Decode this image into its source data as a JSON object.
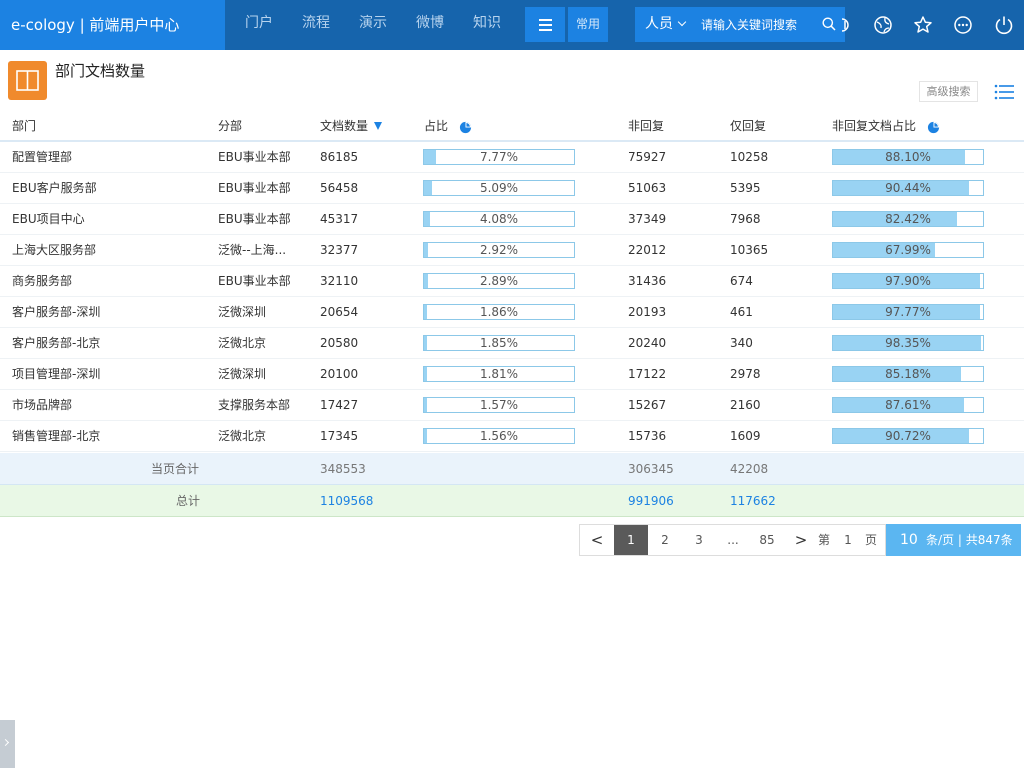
{
  "brand": "e-cology | 前端用户中心",
  "nav": [
    "门户",
    "流程",
    "演示",
    "微博",
    "知识"
  ],
  "common_label": "常用",
  "search": {
    "type": "人员",
    "placeholder": "请输入关键词搜索"
  },
  "title": "部门文档数量",
  "advanced_search_label": "高级搜索",
  "columns": [
    "部门",
    "分部",
    "文档数量",
    "占比",
    "非回复",
    "仅回复",
    "非回复文档占比"
  ],
  "rows": [
    {
      "dept": "配置管理部",
      "branch": "EBU事业本部",
      "docs": "86185",
      "pct": "7.77%",
      "pct_value": 0.0777,
      "nonreply": "75927",
      "reply": "10258",
      "nonreply_pct": "88.10%",
      "nonreply_value": 0.881
    },
    {
      "dept": "EBU客户服务部",
      "branch": "EBU事业本部",
      "docs": "56458",
      "pct": "5.09%",
      "pct_value": 0.0509,
      "nonreply": "51063",
      "reply": "5395",
      "nonreply_pct": "90.44%",
      "nonreply_value": 0.9044
    },
    {
      "dept": "EBU项目中心",
      "branch": "EBU事业本部",
      "docs": "45317",
      "pct": "4.08%",
      "pct_value": 0.0408,
      "nonreply": "37349",
      "reply": "7968",
      "nonreply_pct": "82.42%",
      "nonreply_value": 0.8242
    },
    {
      "dept": "上海大区服务部",
      "branch": "泛微--上海...",
      "docs": "32377",
      "pct": "2.92%",
      "pct_value": 0.0292,
      "nonreply": "22012",
      "reply": "10365",
      "nonreply_pct": "67.99%",
      "nonreply_value": 0.6799
    },
    {
      "dept": "商务服务部",
      "branch": "EBU事业本部",
      "docs": "32110",
      "pct": "2.89%",
      "pct_value": 0.0289,
      "nonreply": "31436",
      "reply": "674",
      "nonreply_pct": "97.90%",
      "nonreply_value": 0.979
    },
    {
      "dept": "客户服务部-深圳",
      "branch": "泛微深圳",
      "docs": "20654",
      "pct": "1.86%",
      "pct_value": 0.0186,
      "nonreply": "20193",
      "reply": "461",
      "nonreply_pct": "97.77%",
      "nonreply_value": 0.9777
    },
    {
      "dept": "客户服务部-北京",
      "branch": "泛微北京",
      "docs": "20580",
      "pct": "1.85%",
      "pct_value": 0.0185,
      "nonreply": "20240",
      "reply": "340",
      "nonreply_pct": "98.35%",
      "nonreply_value": 0.9835
    },
    {
      "dept": "项目管理部-深圳",
      "branch": "泛微深圳",
      "docs": "20100",
      "pct": "1.81%",
      "pct_value": 0.0181,
      "nonreply": "17122",
      "reply": "2978",
      "nonreply_pct": "85.18%",
      "nonreply_value": 0.8518
    },
    {
      "dept": "市场品牌部",
      "branch": "支撑服务本部",
      "docs": "17427",
      "pct": "1.57%",
      "pct_value": 0.0157,
      "nonreply": "15267",
      "reply": "2160",
      "nonreply_pct": "87.61%",
      "nonreply_value": 0.8761
    },
    {
      "dept": "销售管理部-北京",
      "branch": "泛微北京",
      "docs": "17345",
      "pct": "1.56%",
      "pct_value": 0.0156,
      "nonreply": "15736",
      "reply": "1609",
      "nonreply_pct": "90.72%",
      "nonreply_value": 0.9072
    }
  ],
  "page_sum": {
    "label": "当页合计",
    "docs": "348553",
    "nonreply": "306345",
    "reply": "42208"
  },
  "total": {
    "label": "总计",
    "docs": "1109568",
    "nonreply": "991906",
    "reply": "117662"
  },
  "pagination": {
    "prev": "<",
    "next": ">",
    "pages": [
      "1",
      "2",
      "3",
      "...",
      "85"
    ],
    "current": "1",
    "goto_prefix": "第",
    "goto_value": "1",
    "goto_suffix": "页",
    "page_size": "10",
    "summary": "条/页 | 共847条"
  },
  "colors": {
    "topbar": "#1664ac",
    "accent": "#1c82e2",
    "title_icon": "#f08a2c",
    "bar_fill": "#99d3f3",
    "page_size_bg": "#5bb6f1"
  },
  "icons": [
    "search-icon",
    "chart-icon",
    "globe-icon",
    "star-icon",
    "more-icon",
    "power-icon",
    "book-icon",
    "list-icon",
    "pie-chart-icon"
  ]
}
